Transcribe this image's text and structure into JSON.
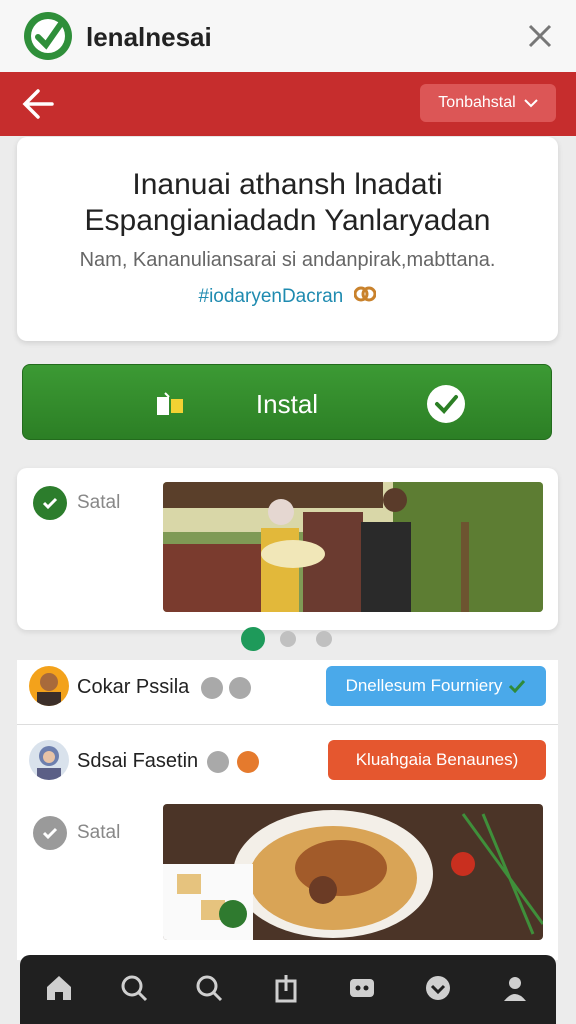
{
  "app": {
    "title": "lenalnesai"
  },
  "header": {
    "dropdown_label": "Tonbahstal"
  },
  "hero": {
    "title_line1": "Inanuai athansh lnadati",
    "title_line2": "Espangianiadadn Yanlaryadan",
    "subtitle": "Nam, Kananuliansarai si andanpirak,mabttana.",
    "tag": "#iodaryenDacran"
  },
  "install": {
    "label": "Instal"
  },
  "feed": {
    "post1": {
      "status": "Satal"
    },
    "carousel": {
      "count": 3,
      "active_index": 0
    },
    "row1": {
      "name": "Cokar Pssila",
      "button": "Dnellesum Fourniery"
    },
    "row2": {
      "name": "Sdsai Fasetin",
      "button": "Kluahgaia Benaunes)"
    },
    "post2": {
      "status": "Satal"
    }
  },
  "colors": {
    "red_bar": "#c62d2d",
    "install_green": "#3c9a34",
    "blue_button": "#4aa9ea",
    "orange_button": "#e5572f",
    "nav_bg": "#202020"
  },
  "nav": {
    "icons": [
      "home-icon",
      "search-icon",
      "search-icon",
      "share-icon",
      "chat-icon",
      "compass-icon",
      "profile-icon"
    ]
  }
}
